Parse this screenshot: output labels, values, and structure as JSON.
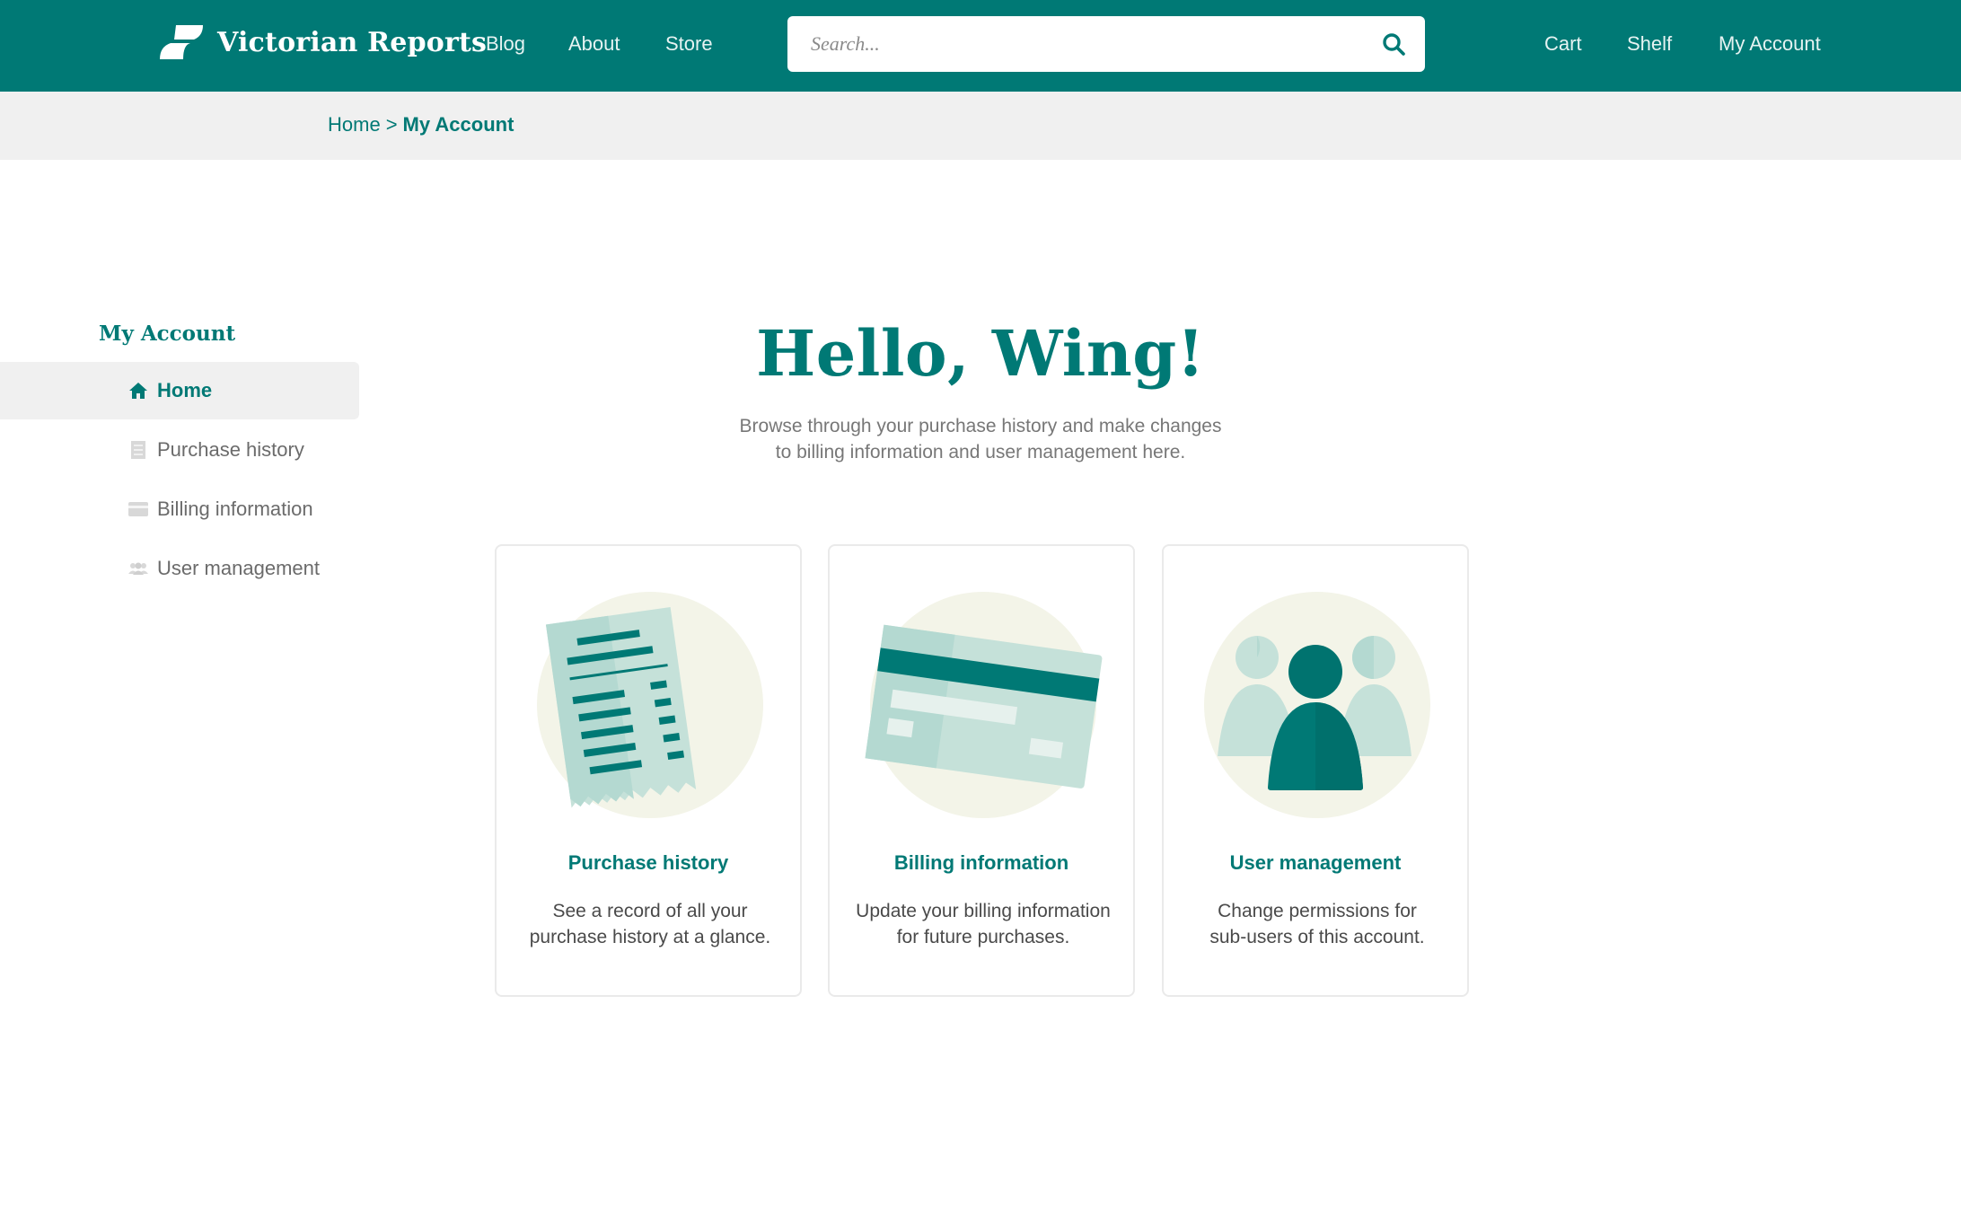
{
  "header": {
    "brand": "Victorian Reports",
    "nav_left": [
      "Blog",
      "About",
      "Store"
    ],
    "search_placeholder": "Search...",
    "nav_right": [
      "Cart",
      "Shelf",
      "My Account"
    ]
  },
  "breadcrumb": {
    "home": "Home",
    "separator": ">",
    "current": "My Account"
  },
  "sidebar": {
    "title": "My Account",
    "items": [
      {
        "label": "Home",
        "icon": "home-icon",
        "active": true
      },
      {
        "label": "Purchase history",
        "icon": "receipt-icon",
        "active": false
      },
      {
        "label": "Billing information",
        "icon": "credit-card-icon",
        "active": false
      },
      {
        "label": "User management",
        "icon": "users-icon",
        "active": false
      }
    ]
  },
  "main": {
    "greeting": "Hello, Wing!",
    "intro_line1": "Browse through your purchase history and make changes",
    "intro_line2": "to billing information and user management here.",
    "cards": [
      {
        "title": "Purchase history",
        "desc_line1": "See a record of all your",
        "desc_line2": "purchase history at a glance.",
        "icon": "receipt-illustration"
      },
      {
        "title": "Billing information",
        "desc_line1": "Update your billing information",
        "desc_line2": "for future purchases.",
        "icon": "credit-card-illustration"
      },
      {
        "title": "User management",
        "desc_line1": "Change permissions for",
        "desc_line2": "sub-users of this account.",
        "icon": "users-illustration"
      }
    ]
  },
  "colors": {
    "brand": "#007975",
    "brand_light": "#b4d9d1",
    "illustration_bg": "#f3f4e8",
    "breadcrumb_bg": "#f0f0f0"
  }
}
